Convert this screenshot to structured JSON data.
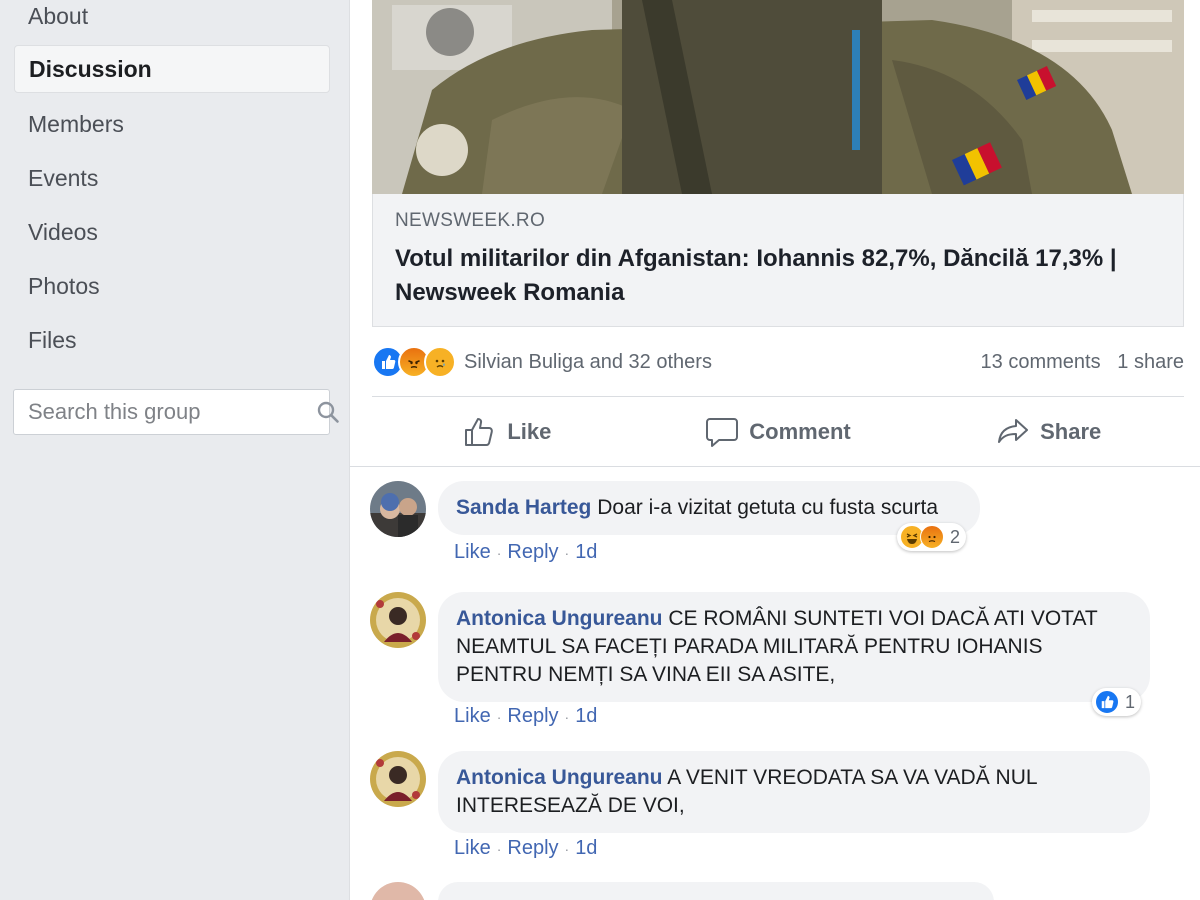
{
  "sidebar": {
    "items": [
      {
        "label": "About"
      },
      {
        "label": "Discussion"
      },
      {
        "label": "Members"
      },
      {
        "label": "Events"
      },
      {
        "label": "Videos"
      },
      {
        "label": "Photos"
      },
      {
        "label": "Files"
      }
    ],
    "active_item": "Discussion",
    "search": {
      "placeholder": "Search this group",
      "value": ""
    }
  },
  "post": {
    "link": {
      "domain": "NEWSWEEK.RO",
      "title": "Votul militarilor din Afganistan: Iohannis 82,7%, Dăncilă 17,3% | Newsweek Romania"
    },
    "reactions": {
      "icons": [
        "like-reaction",
        "angry-reaction",
        "sad-reaction"
      ],
      "text": "Silvian Buliga and 32 others",
      "comments": "13 comments",
      "shares": "1 share"
    },
    "actions": {
      "like": "Like",
      "comment": "Comment",
      "share": "Share"
    }
  },
  "comments": [
    {
      "author": "Sanda Harteg",
      "text": "Doar i-a vizitat getuta cu fusta scurta",
      "like": "Like",
      "reply": "Reply",
      "time": "1d",
      "reaction_icons": [
        "haha-reaction",
        "angry-reaction"
      ],
      "reaction_count": "2"
    },
    {
      "author": "Antonica Ungureanu",
      "text": "CE ROMÂNI SUNTETI VOI DACĂ ATI VOTAT NEAMTUL SA FACEȚI PARADA MILITARĂ PENTRU IOHANIS PENTRU NEMȚI SA VINA EII SA ASITE,",
      "like": "Like",
      "reply": "Reply",
      "time": "1d",
      "reaction_icons": [
        "like-reaction"
      ],
      "reaction_count": "1"
    },
    {
      "author": "Antonica Ungureanu",
      "text": "A VENIT VREODATA SA VA VADĂ NUL INTERESEAZĂ DE VOI,",
      "like": "Like",
      "reply": "Reply",
      "time": "1d"
    }
  ],
  "colors": {
    "link_blue": "#385898",
    "action_blue": "#4267b2",
    "like_blue": "#1877f2",
    "angry_orange": "#e9710f",
    "emoji_yellow": "#f7b125"
  }
}
